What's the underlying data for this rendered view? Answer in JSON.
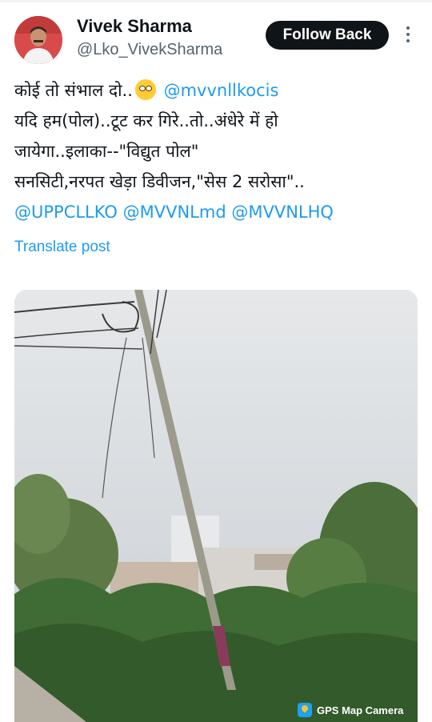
{
  "header": {
    "display_name": "Vivek Sharma",
    "handle": "@Lko_VivekSharma",
    "follow_label": "Follow Back",
    "more_icon": "more-vertical-icon"
  },
  "post": {
    "line1_text": "कोई तो संभाल दो..",
    "line1_emoji": "rolling-eyes-emoji",
    "line1_mention": "@mvvnllkocis",
    "line2": "यदि हम(पोल)..टूट कर गिरे..तो..अंधेरे में हो",
    "line3": "जायेगा..इलाका--\"विद्युत पोल\"",
    "line4": "सनसिटी,नरपत खेड़ा डिवीजन,\"सेस 2 सरोसा\"..",
    "mentions": [
      "@UPPCLLKO",
      "@MVVNLmd",
      "@MVVNLHQ"
    ],
    "translate_label": "Translate post"
  },
  "media": {
    "watermark": "GPS Map Camera",
    "colors": {
      "sky": "#dfe3e6",
      "foliage": "#3f6b34",
      "pole": "#9c9a8a"
    }
  }
}
